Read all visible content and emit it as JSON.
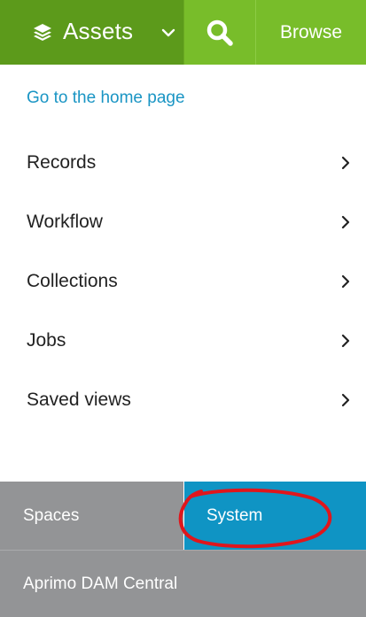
{
  "header": {
    "assets_label": "Assets",
    "assets_icon": "layers-icon",
    "dropdown_icon": "chevron-down-icon",
    "search_icon": "search-icon",
    "browse_label": "Browse",
    "colors": {
      "primary": "#5c9a1b",
      "secondary": "#78bd2a"
    }
  },
  "home_link": "Go to the home page",
  "menu": {
    "items": [
      {
        "label": "Records"
      },
      {
        "label": "Workflow"
      },
      {
        "label": "Collections"
      },
      {
        "label": "Jobs"
      },
      {
        "label": "Saved views"
      }
    ]
  },
  "footer": {
    "spaces_label": "Spaces",
    "system_label": "System",
    "system_color": "#0f94c4",
    "dam_label": "Aprimo DAM Central",
    "annotation_color": "#e0161c"
  }
}
